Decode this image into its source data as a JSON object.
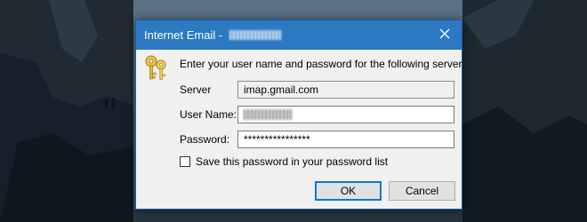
{
  "dialog": {
    "title": "Internet Email - ",
    "prompt": "Enter your user name and password for the following server.",
    "server_label": "Server",
    "server_value": "imap.gmail.com",
    "username_label": "User Name:",
    "password_label": "Password:",
    "password_value": "****************",
    "save_password_label": "Save this password in your password list",
    "save_password_checked": false,
    "ok_label": "OK",
    "cancel_label": "Cancel"
  },
  "icons": {
    "close": "close-icon",
    "keys": "keys-icon"
  },
  "colors": {
    "titlebar": "#2b79c3",
    "dialog_bg": "#f0f0f0",
    "default_button_border": "#0a76d6"
  }
}
